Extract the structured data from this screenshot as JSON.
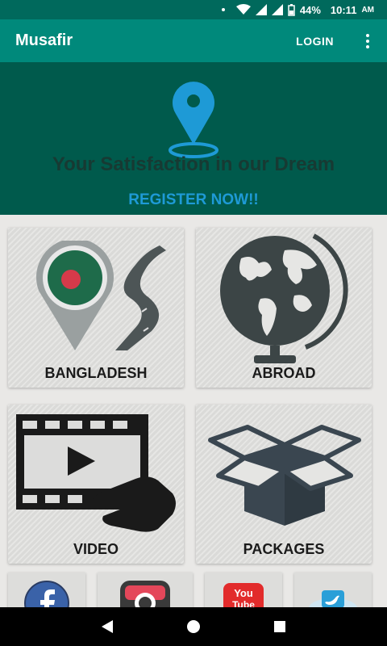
{
  "status_bar": {
    "battery": "44%",
    "time": "10:11",
    "ampm": "AM"
  },
  "app_bar": {
    "title": "Musafir",
    "login_label": "LOGIN"
  },
  "hero": {
    "tagline": "Your Satisfaction in our Dream",
    "register_label": "REGISTER NOW!!"
  },
  "tiles": [
    {
      "label": "BANGLADESH",
      "icon": "bangladesh-map-pin-road-icon"
    },
    {
      "label": "ABROAD",
      "icon": "globe-icon"
    },
    {
      "label": "VIDEO",
      "icon": "video-film-touch-icon"
    },
    {
      "label": "PACKAGES",
      "icon": "open-box-icon"
    }
  ],
  "social": [
    "facebook-icon",
    "instagram-icon",
    "youtube-icon",
    "twitter-icon"
  ],
  "youtube_text": [
    "You",
    "Tube"
  ],
  "colors": {
    "status_bar": "#00695c",
    "app_bar": "#00897b",
    "hero_bg": "#005a4c",
    "register": "#1e9ad6",
    "pin": "#1e9ad6"
  }
}
